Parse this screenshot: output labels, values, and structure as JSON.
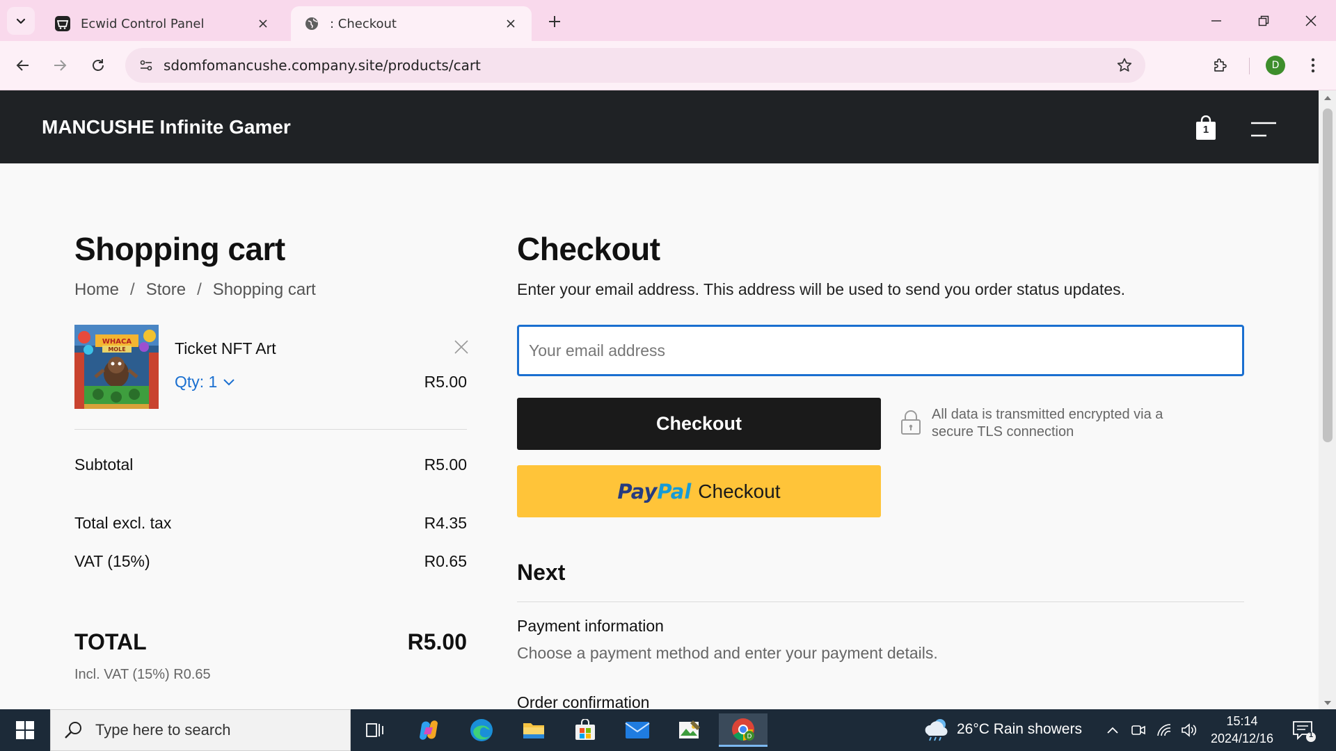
{
  "browser": {
    "tabs": [
      {
        "title": "Ecwid Control Panel",
        "active": false
      },
      {
        "title": ": Checkout",
        "active": true
      }
    ],
    "url": "sdomfomancushe.company.site/products/cart",
    "profile_initial": "D"
  },
  "store": {
    "name": "MANCUSHE Infinite Gamer",
    "cart_count": "1"
  },
  "cart": {
    "title": "Shopping cart",
    "breadcrumb": [
      "Home",
      "Store",
      "Shopping cart"
    ],
    "items": [
      {
        "name": "Ticket NFT Art",
        "qty_label": "Qty: 1",
        "price": "R5.00"
      }
    ],
    "summary": [
      {
        "label": "Subtotal",
        "value": "R5.00"
      },
      {
        "label": "Total excl. tax",
        "value": "R4.35"
      },
      {
        "label": "VAT (15%)",
        "value": "R0.65"
      }
    ],
    "total_label": "TOTAL",
    "total_value": "R5.00",
    "total_note": "Incl. VAT (15%) R0.65"
  },
  "checkout": {
    "title": "Checkout",
    "description": "Enter your email address. This address will be used to send you order status updates.",
    "email_placeholder": "Your email address",
    "email_value": "",
    "checkout_button": "Checkout",
    "secure_note": "All data is transmitted encrypted via a secure TLS connection",
    "paypal": {
      "pay": "Pay",
      "pal": "Pal",
      "label": "Checkout"
    },
    "next_title": "Next",
    "steps": [
      {
        "title": "Payment information",
        "desc": "Choose a payment method and enter your payment details."
      },
      {
        "title": "Order confirmation",
        "desc": ""
      }
    ]
  },
  "taskbar": {
    "search_placeholder": "Type here to search",
    "weather": "26°C  Rain showers",
    "time": "15:14",
    "date": "2024/12/16",
    "notification_count": "1"
  },
  "colors": {
    "store_header": "#1f2225",
    "link_blue": "#1a6fd0",
    "paypal_yellow": "#ffc439",
    "tabstrip": "#f9d9ec"
  }
}
